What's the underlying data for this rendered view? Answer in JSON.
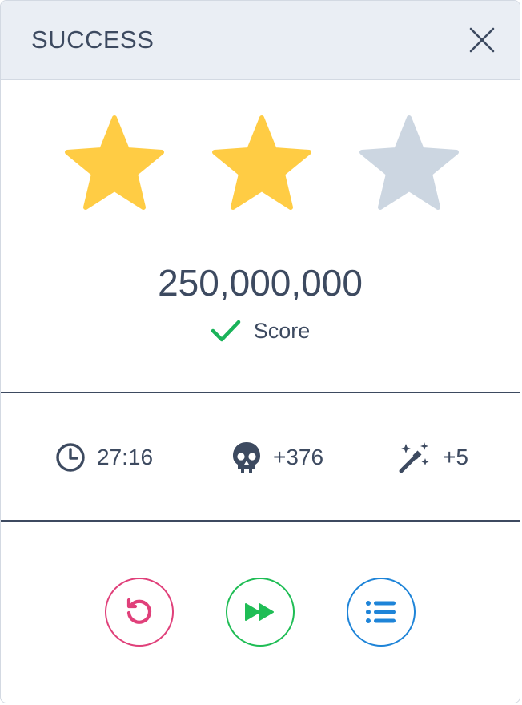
{
  "header": {
    "title": "SUCCESS",
    "close_icon": "close-icon"
  },
  "rating": {
    "earned": 2,
    "total": 3,
    "colors": {
      "earned": "#ffcc44",
      "empty": "#ccd6e1"
    }
  },
  "score": {
    "value": "250,000,000",
    "label": "Score",
    "check_color": "#1ab35a"
  },
  "stats": {
    "time": {
      "icon": "clock-icon",
      "value": "27:16"
    },
    "kills": {
      "icon": "skull-icon",
      "value": "+376"
    },
    "magic": {
      "icon": "magic-wand-icon",
      "value": "+5"
    }
  },
  "actions": {
    "retry": {
      "icon": "retry-icon",
      "color": "#e0407a"
    },
    "next": {
      "icon": "fast-forward-icon",
      "color": "#1fbd55"
    },
    "menu": {
      "icon": "list-icon",
      "color": "#1e84d8"
    }
  }
}
